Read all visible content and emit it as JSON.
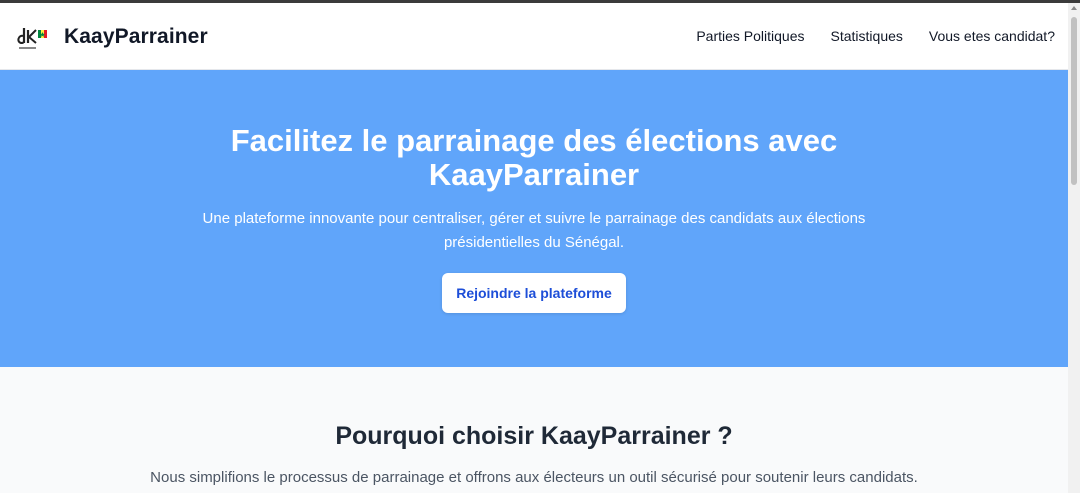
{
  "header": {
    "brand": "KaayParrainer",
    "nav": [
      {
        "label": "Parties Politiques"
      },
      {
        "label": "Statistiques"
      },
      {
        "label": "Vous etes candidat?"
      }
    ]
  },
  "hero": {
    "title": "Facilitez le parrainage des élections avec KaayParrainer",
    "subtitle": "Une plateforme innovante pour centraliser, gérer et suivre le parrainage des candidats aux élections présidentielles du Sénégal.",
    "cta_label": "Rejoindre la plateforme"
  },
  "features": {
    "title": "Pourquoi choisir KaayParrainer ?",
    "subtitle": "Nous simplifions le processus de parrainage et offrons aux électeurs un outil sécurisé pour soutenir leurs candidats."
  },
  "colors": {
    "hero_bg": "#60a5fa",
    "cta_text": "#1d4ed8",
    "features_bg": "#f9fafb"
  },
  "icons": {
    "logo": "dk-flag-logo-icon"
  }
}
